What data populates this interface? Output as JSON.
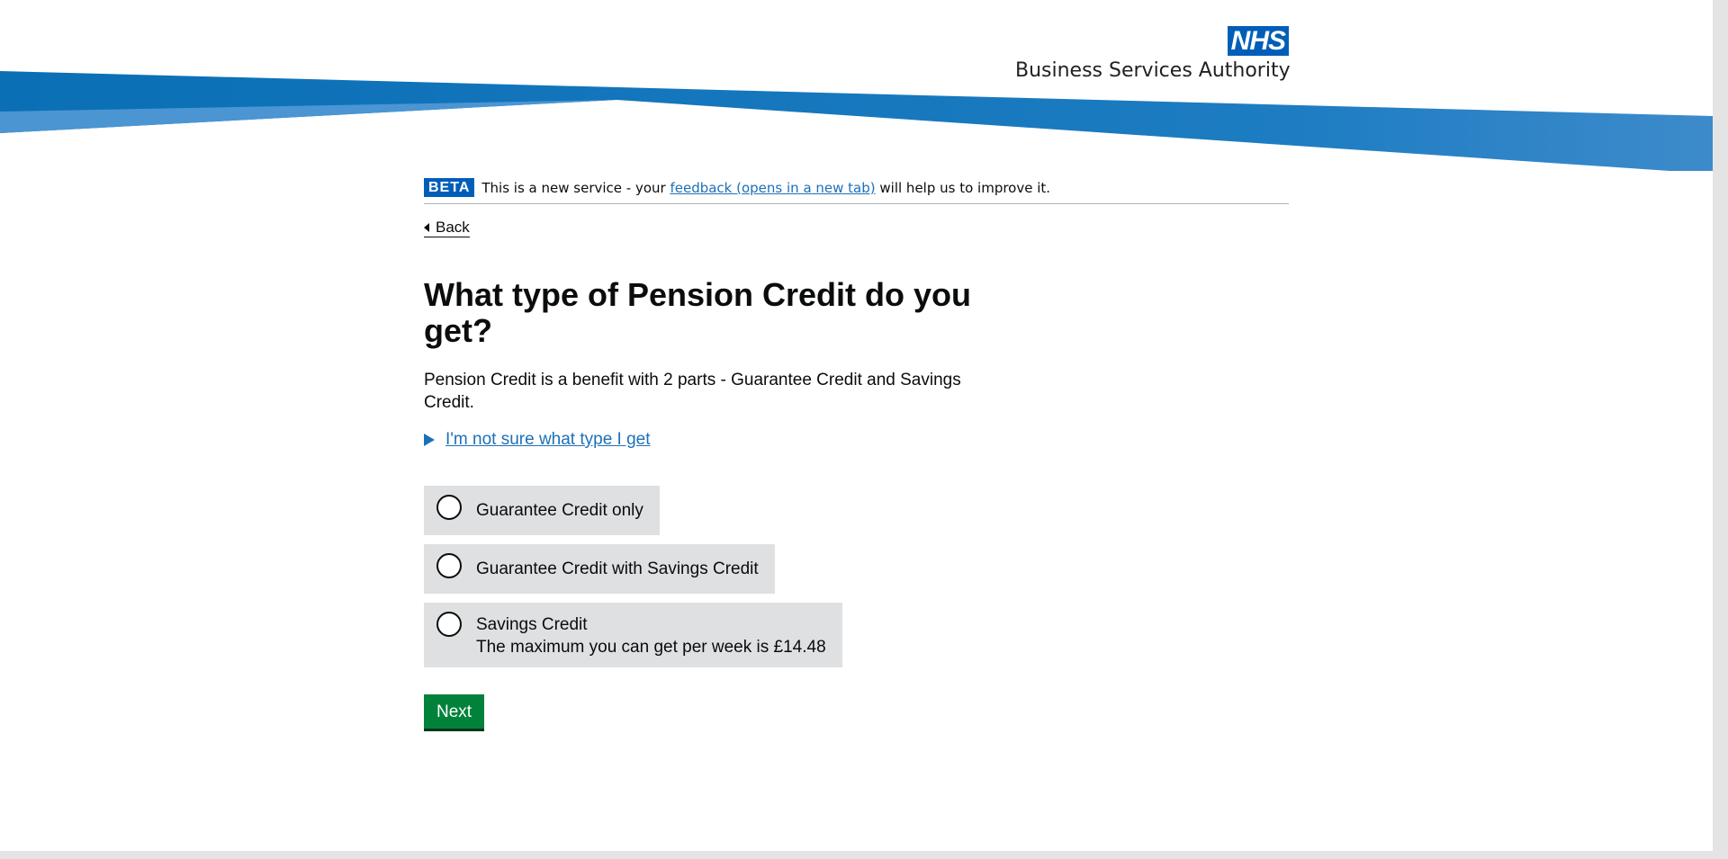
{
  "header": {
    "logo_mark": "NHS",
    "logo_text": "Business Services Authority"
  },
  "phase_banner": {
    "tag": "BETA",
    "text_before": "This is a new service - your ",
    "link_text": "feedback (opens in a new tab)",
    "text_after": " will help us to improve it."
  },
  "back_link": {
    "label": "Back"
  },
  "question": {
    "title": "What type of Pension Credit do you get?",
    "hint": "Pension Credit is a benefit with 2 parts - Guarantee Credit and Savings Credit.",
    "details_summary": "I'm not sure what type I get"
  },
  "options": [
    {
      "label": "Guarantee Credit only",
      "hint": ""
    },
    {
      "label": "Guarantee Credit with Savings Credit",
      "hint": ""
    },
    {
      "label": "Savings Credit",
      "hint": "The maximum you can get per week is £14.48"
    }
  ],
  "actions": {
    "next_label": "Next"
  },
  "colors": {
    "nhs_blue": "#005eb8",
    "link_blue": "#1d70b8",
    "button_green": "#00823b",
    "radio_bg": "#dee0e2"
  }
}
